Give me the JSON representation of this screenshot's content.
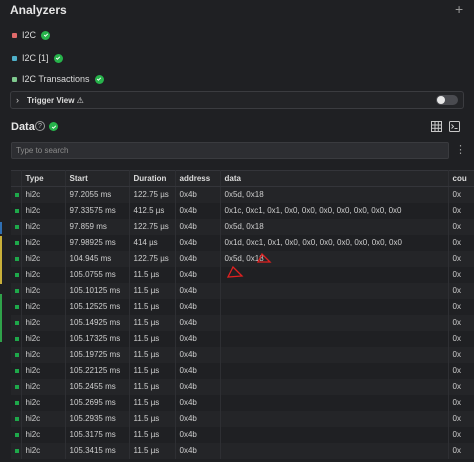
{
  "analyzers": {
    "title": "Analyzers",
    "add_label": "+",
    "items": [
      {
        "label": "I2C",
        "color": "#e06a6a"
      },
      {
        "label": "I2C [1]",
        "color": "#4fb0c9"
      },
      {
        "label": "I2C Transactions",
        "color": "#7fc98e"
      }
    ],
    "trigger_view": {
      "label": "Trigger View",
      "warning_icon": "⚠",
      "enabled": false
    }
  },
  "data_panel": {
    "title": "Data",
    "help_label": "?",
    "search_placeholder": "Type to search",
    "columns": [
      "Type",
      "Start",
      "Duration",
      "address",
      "data",
      "cou"
    ],
    "rows": [
      {
        "type": "hi2c",
        "start": "97.2055 ms",
        "duration": "122.75 µs",
        "address": "0x4b",
        "data": "0x5d, 0x18",
        "count": "0x"
      },
      {
        "type": "hi2c",
        "start": "97.33575 ms",
        "duration": "412.5 µs",
        "address": "0x4b",
        "data": "0x1c, 0xc1, 0x1, 0x0, 0x0, 0x0, 0x0, 0x0, 0x0, 0x0",
        "count": "0x"
      },
      {
        "type": "hi2c",
        "start": "97.859 ms",
        "duration": "122.75 µs",
        "address": "0x4b",
        "data": "0x5d, 0x18",
        "count": "0x"
      },
      {
        "type": "hi2c",
        "start": "97.98925 ms",
        "duration": "414 µs",
        "address": "0x4b",
        "data": "0x1d, 0xc1, 0x1, 0x0, 0x0, 0x0, 0x0, 0x0, 0x0, 0x0",
        "count": "0x"
      },
      {
        "type": "hi2c",
        "start": "104.945 ms",
        "duration": "122.75 µs",
        "address": "0x4b",
        "data": "0x5d, 0x18",
        "count": "0x"
      },
      {
        "type": "hi2c",
        "start": "105.0755 ms",
        "duration": "11.5 µs",
        "address": "0x4b",
        "data": "",
        "count": "0x"
      },
      {
        "type": "hi2c",
        "start": "105.10125 ms",
        "duration": "11.5 µs",
        "address": "0x4b",
        "data": "",
        "count": "0x"
      },
      {
        "type": "hi2c",
        "start": "105.12525 ms",
        "duration": "11.5 µs",
        "address": "0x4b",
        "data": "",
        "count": "0x"
      },
      {
        "type": "hi2c",
        "start": "105.14925 ms",
        "duration": "11.5 µs",
        "address": "0x4b",
        "data": "",
        "count": "0x"
      },
      {
        "type": "hi2c",
        "start": "105.17325 ms",
        "duration": "11.5 µs",
        "address": "0x4b",
        "data": "",
        "count": "0x"
      },
      {
        "type": "hi2c",
        "start": "105.19725 ms",
        "duration": "11.5 µs",
        "address": "0x4b",
        "data": "",
        "count": "0x"
      },
      {
        "type": "hi2c",
        "start": "105.22125 ms",
        "duration": "11.5 µs",
        "address": "0x4b",
        "data": "",
        "count": "0x"
      },
      {
        "type": "hi2c",
        "start": "105.2455 ms",
        "duration": "11.5 µs",
        "address": "0x4b",
        "data": "",
        "count": "0x"
      },
      {
        "type": "hi2c",
        "start": "105.2695 ms",
        "duration": "11.5 µs",
        "address": "0x4b",
        "data": "",
        "count": "0x"
      },
      {
        "type": "hi2c",
        "start": "105.2935 ms",
        "duration": "11.5 µs",
        "address": "0x4b",
        "data": "",
        "count": "0x"
      },
      {
        "type": "hi2c",
        "start": "105.3175 ms",
        "duration": "11.5 µs",
        "address": "0x4b",
        "data": "",
        "count": "0x"
      },
      {
        "type": "hi2c",
        "start": "105.3415 ms",
        "duration": "11.5 µs",
        "address": "0x4b",
        "data": "",
        "count": "0x"
      }
    ]
  },
  "colors": {
    "background": "#1f2023",
    "check": "#27b34b",
    "row_marker": "#1ea84a",
    "annotation": "#e02020"
  }
}
